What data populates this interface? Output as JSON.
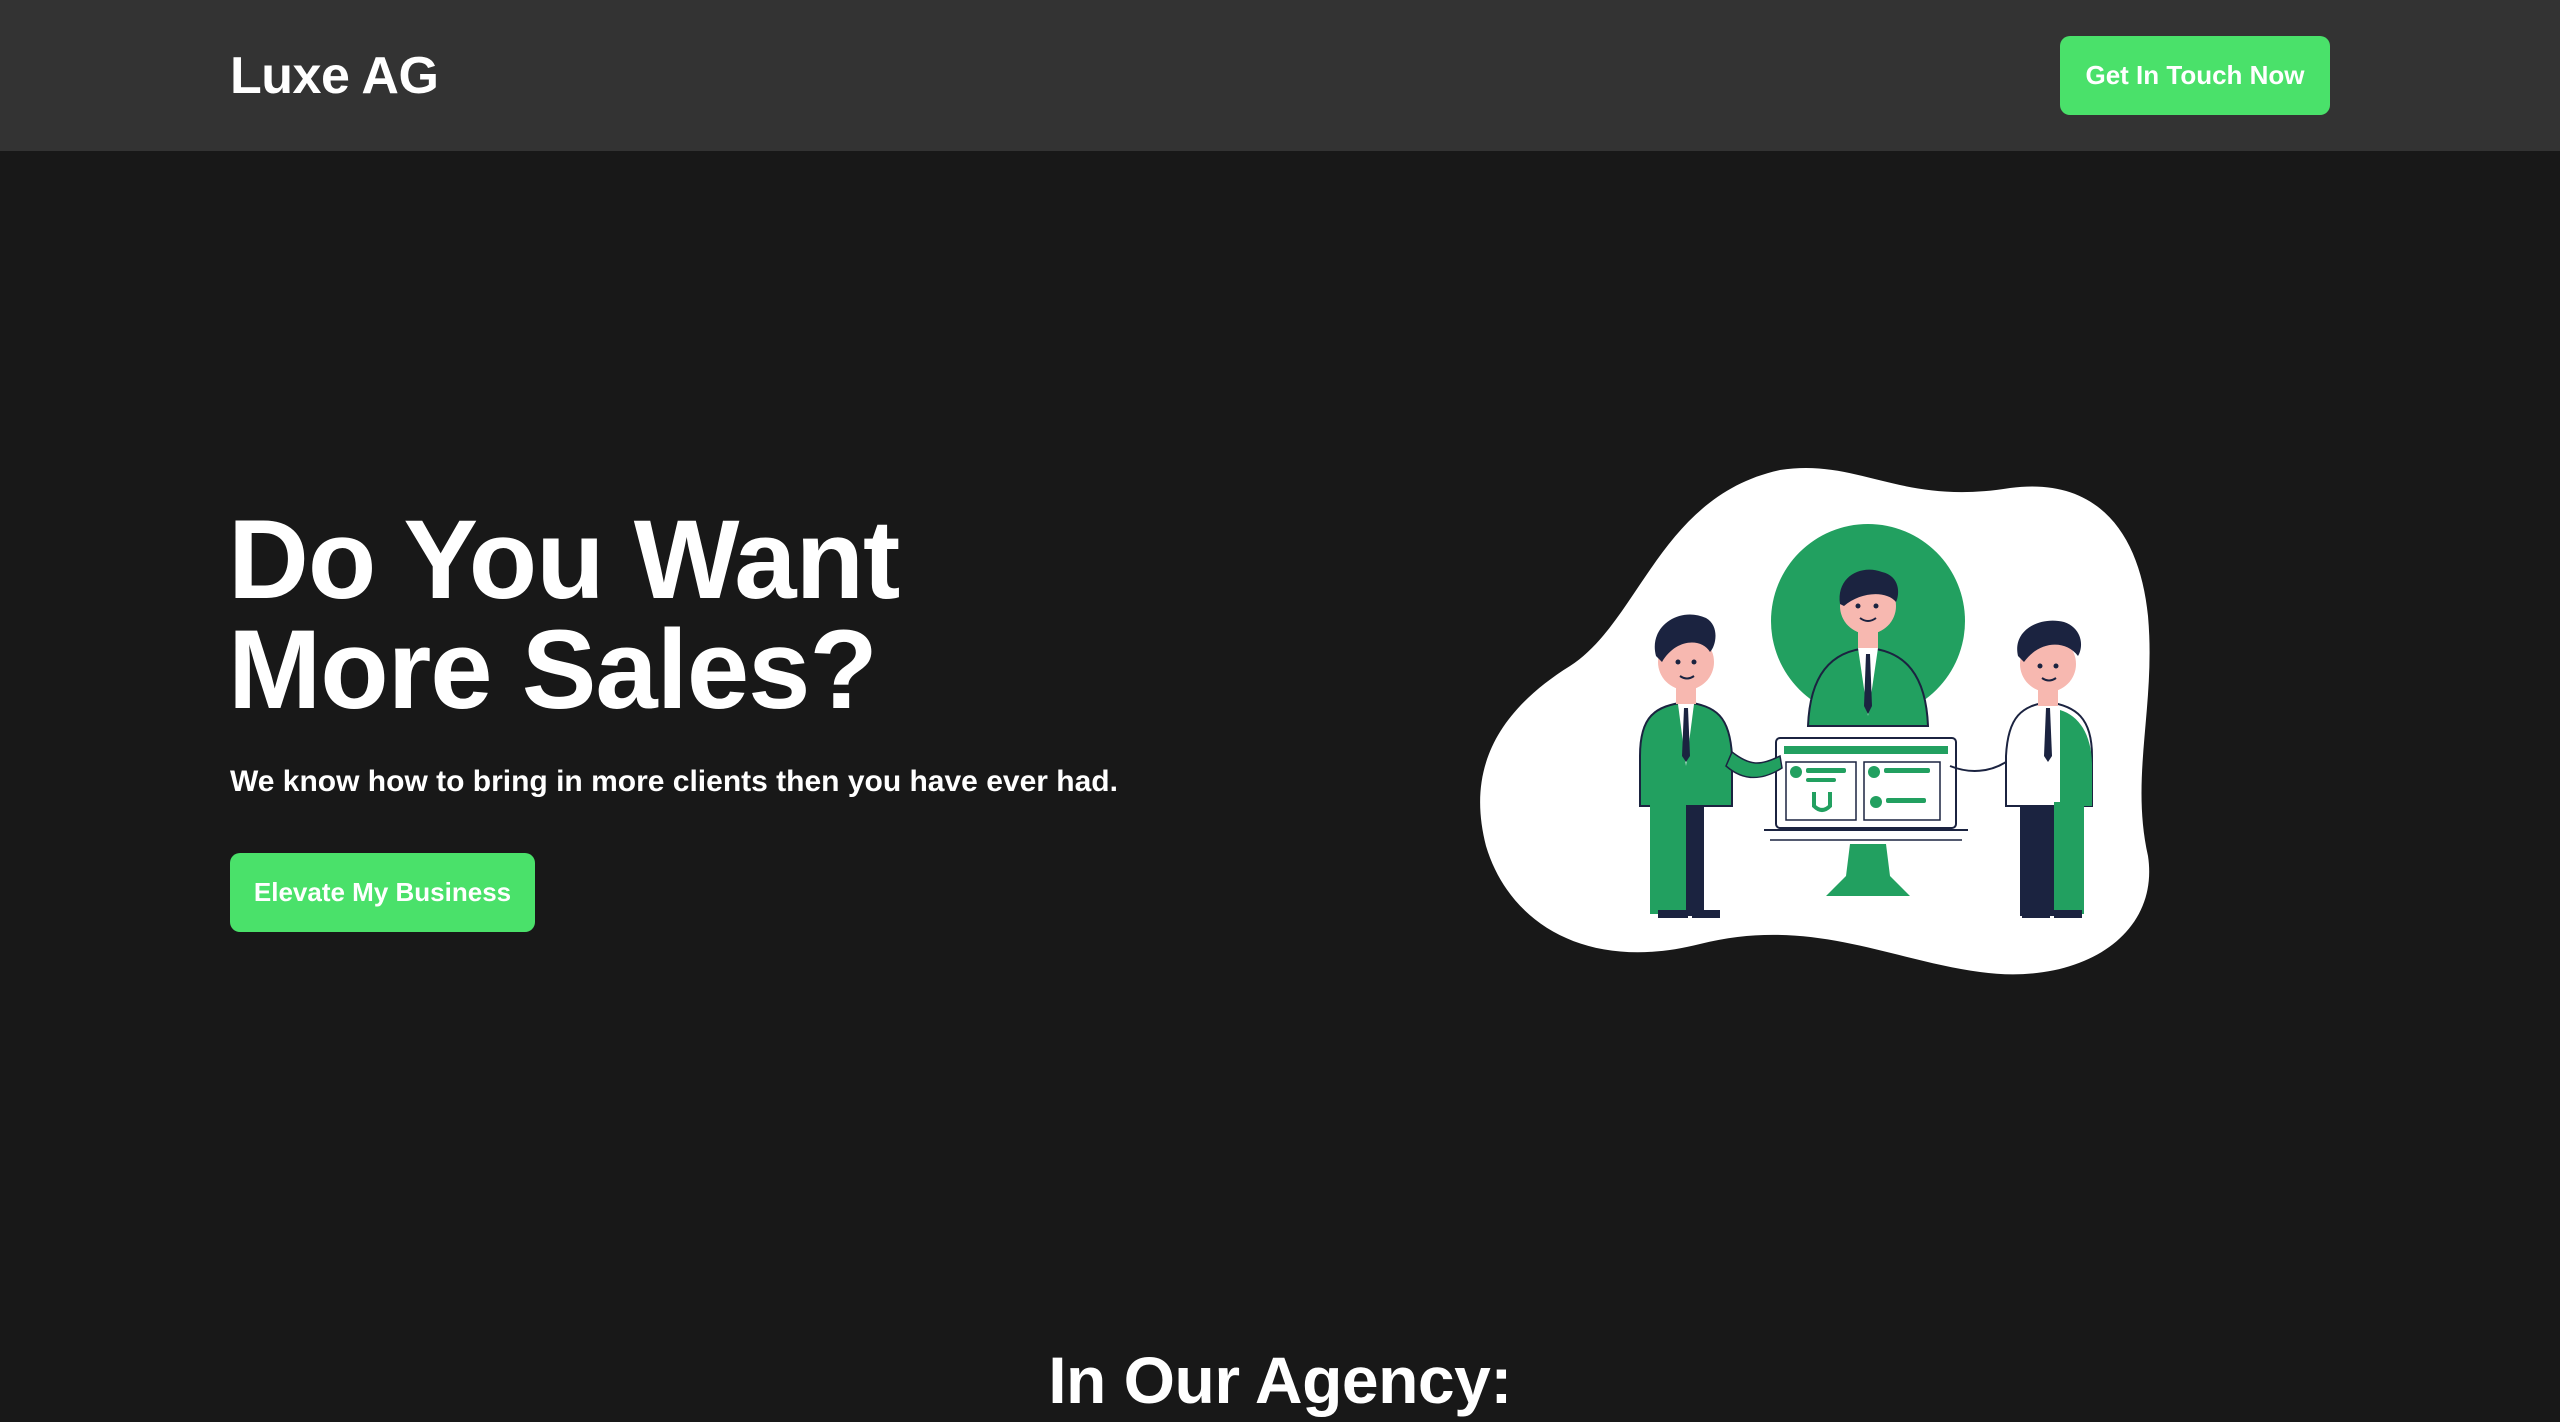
{
  "header": {
    "brand": "Luxe AG",
    "cta_label": "Get In Touch Now"
  },
  "hero": {
    "title_line1": "Do You Want",
    "title_line2": "More Sales?",
    "subtitle": "We know how to bring in more clients then you have ever had.",
    "cta_label": "Elevate My Business",
    "illustration": "business-team-illustration"
  },
  "section": {
    "title": "In Our Agency:"
  },
  "colors": {
    "background": "#181818",
    "navbar": "#333333",
    "accent": "#4ae16a",
    "illustration_green": "#22a060",
    "illustration_navy": "#1b2340"
  }
}
